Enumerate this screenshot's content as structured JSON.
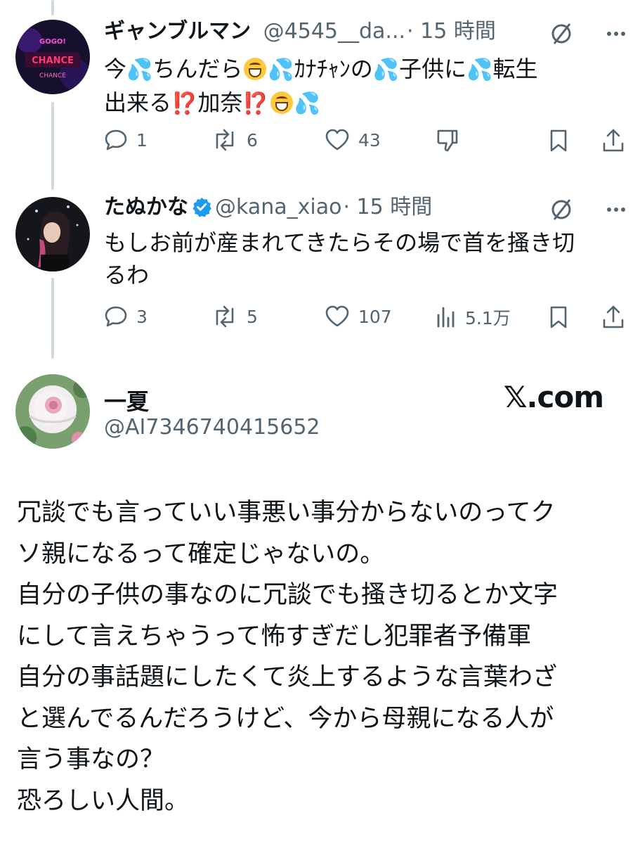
{
  "tweet1": {
    "name": "ギャンブルマン",
    "handle": "@4545__da...",
    "time": "· 15 時間",
    "text_parts": [
      "今",
      "ちんだら",
      "ｶﾅﾁｬﾝの",
      "子供に",
      "転生",
      "出来る",
      "加奈"
    ],
    "emoji_sweat": "💦",
    "emoji_bang": "⁉️",
    "actions": {
      "replies": "1",
      "reposts": "6",
      "likes": "43"
    },
    "avatar_text": {
      "l1": "GOGO!",
      "l2": "CHANCE",
      "l3": "CHANCE"
    }
  },
  "tweet2": {
    "name": "たぬかな",
    "handle": "@kana_xiao",
    "time": "· 15 時間",
    "text_line1": "もしお前が産まれてきたらその場で首を搔き切",
    "text_line2": "るわ",
    "actions": {
      "replies": "3",
      "reposts": "5",
      "likes": "107",
      "views": "5.1万"
    }
  },
  "quote": {
    "name": "一夏",
    "handle": "@AI7346740415652",
    "brand": "𝕏.com",
    "lines": [
      "冗談でも言っていい事悪い事分からないのってク",
      "ソ親になるって確定じゃないの。",
      "自分の子供の事なのに冗談でも搔き切るとか文字",
      "にして言えちゃうって怖すぎだし犯罪者予備軍",
      "自分の事話題にしたくて炎上するような言葉わざ",
      "と選んでるんだろうけど、今から母親になる人が",
      "言う事なの？",
      "恐ろしい人間。"
    ]
  },
  "colors": {
    "text": "#0f1419",
    "meta": "#536471",
    "thread": "#cfd9de",
    "verified": "#1d9bf0"
  }
}
